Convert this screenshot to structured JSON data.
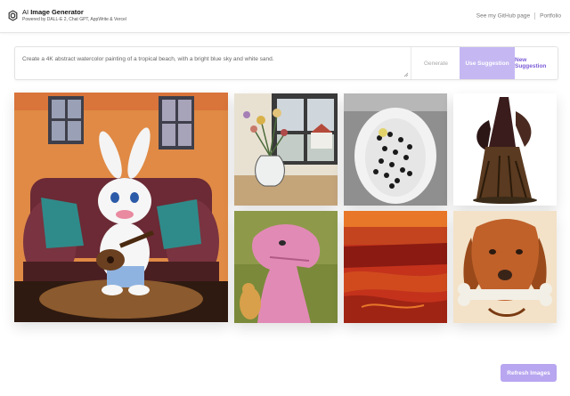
{
  "header": {
    "title_prefix": "AI",
    "title_strong": "Image Generator",
    "subtitle": "Powered by DALL-E 2, Chat GPT, AppWrite & Vercel",
    "nav": {
      "github": "See my GitHub page",
      "portfolio": "Portfolio"
    }
  },
  "prompt": {
    "value": "Create a 4K abstract watercolor painting of a tropical beach, with a bright blue sky and white sand."
  },
  "buttons": {
    "generate": "Generate",
    "use_suggestion": "Use Suggestion",
    "new_suggestion": "New Suggestion",
    "refresh": "Refresh Images"
  },
  "colors": {
    "accent": "#c5b8f2",
    "accent_text": "#7b5cd6",
    "refresh": "#b8a6f0"
  },
  "gallery": {
    "images": [
      "bunny-playing-guitar-on-couch",
      "flowers-in-vase-by-window",
      "bathtub-with-black-hearts",
      "witch-broom-figure",
      "pink-dinosaur-portrait",
      "red-desert-landscape",
      "dog-holding-bone"
    ]
  }
}
